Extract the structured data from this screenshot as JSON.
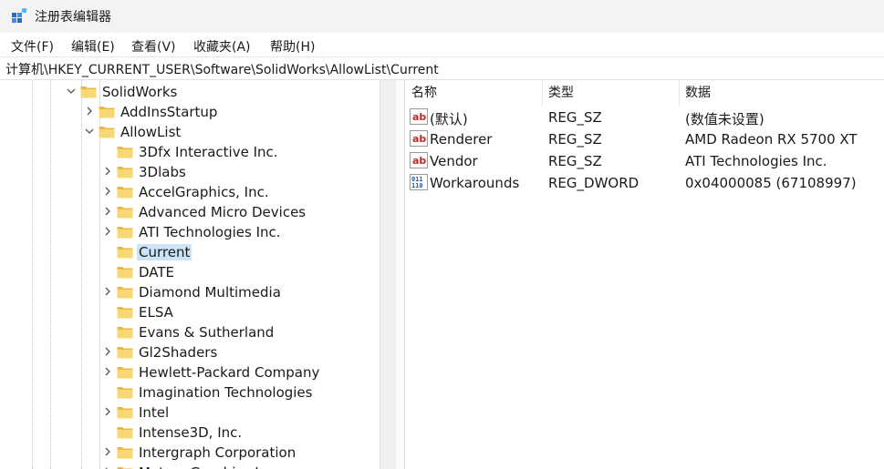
{
  "window": {
    "title": "注册表编辑器"
  },
  "menu": [
    "文件(F)",
    "编辑(E)",
    "查看(V)",
    "收藏夹(A)",
    "帮助(H)"
  ],
  "address": "计算机\\HKEY_CURRENT_USER\\Software\\SolidWorks\\AllowList\\Current",
  "tree": [
    {
      "label": "SolidWorks",
      "expander": "expanded"
    },
    {
      "label": "AddInsStartup",
      "expander": "collapsed"
    },
    {
      "label": "AllowList",
      "expander": "expanded"
    },
    {
      "label": "3Dfx Interactive Inc.",
      "expander": "none"
    },
    {
      "label": "3Dlabs",
      "expander": "collapsed"
    },
    {
      "label": "AccelGraphics, Inc.",
      "expander": "collapsed"
    },
    {
      "label": "Advanced Micro Devices",
      "expander": "collapsed"
    },
    {
      "label": "ATI Technologies Inc.",
      "expander": "collapsed"
    },
    {
      "label": "Current",
      "expander": "none",
      "selected": true
    },
    {
      "label": "DATE",
      "expander": "none"
    },
    {
      "label": "Diamond Multimedia",
      "expander": "collapsed"
    },
    {
      "label": "ELSA",
      "expander": "none"
    },
    {
      "label": "Evans & Sutherland",
      "expander": "none"
    },
    {
      "label": "Gl2Shaders",
      "expander": "collapsed"
    },
    {
      "label": "Hewlett-Packard Company",
      "expander": "collapsed"
    },
    {
      "label": "Imagination Technologies",
      "expander": "none"
    },
    {
      "label": "Intel",
      "expander": "collapsed"
    },
    {
      "label": "Intense3D, Inc.",
      "expander": "none"
    },
    {
      "label": "Intergraph Corporation",
      "expander": "collapsed"
    },
    {
      "label": "Matrox Graphics Inc.",
      "expander": "collapsed"
    }
  ],
  "columns": {
    "name": "名称",
    "type": "类型",
    "data": "数据"
  },
  "values": [
    {
      "icon": "string-value-icon",
      "name": "(默认)",
      "type": "REG_SZ",
      "data": "(数值未设置)"
    },
    {
      "icon": "string-value-icon",
      "name": "Renderer",
      "type": "REG_SZ",
      "data": "AMD Radeon RX 5700 XT"
    },
    {
      "icon": "string-value-icon",
      "name": "Vendor",
      "type": "REG_SZ",
      "data": "ATI Technologies Inc."
    },
    {
      "icon": "dword-value-icon",
      "name": "Workarounds",
      "type": "REG_DWORD",
      "data": "0x04000085 (67108997)"
    }
  ],
  "colors": {
    "selection": "#cce4f7",
    "folder": "#f8d775",
    "folder_dark": "#e8b943",
    "string_icon_red": "#c62828",
    "dword_icon_blue": "#1e5bb8"
  }
}
